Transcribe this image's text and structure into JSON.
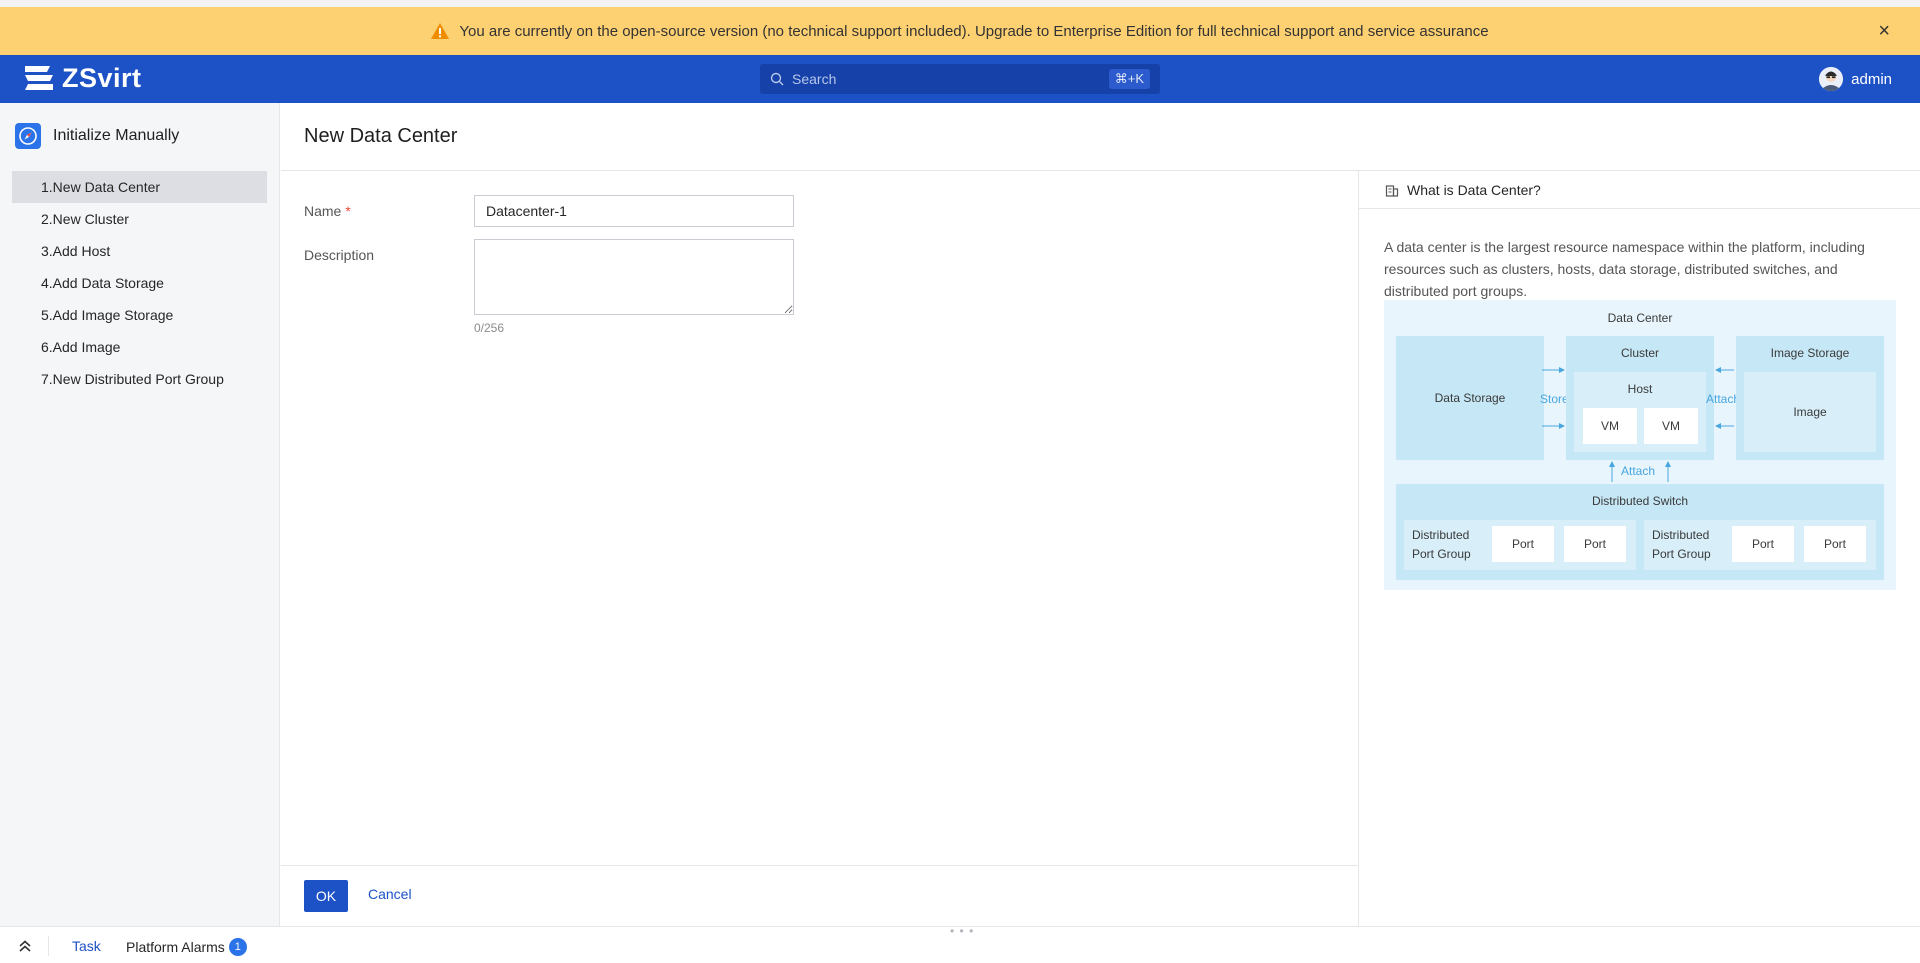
{
  "banner": {
    "message": "You are currently on the open-source version (no technical support included). Upgrade to Enterprise Edition for full technical support and service assurance",
    "close_icon": "×"
  },
  "header": {
    "logo_text": "ZSvirt",
    "search_placeholder": "Search",
    "search_shortcut": "⌘+K",
    "user_name": "admin"
  },
  "sidebar": {
    "title": "Initialize Manually",
    "steps": [
      {
        "label": "1.New Data Center",
        "active": true
      },
      {
        "label": "2.New Cluster"
      },
      {
        "label": "3.Add Host"
      },
      {
        "label": "4.Add Data Storage"
      },
      {
        "label": "5.Add Image Storage"
      },
      {
        "label": "6.Add Image"
      },
      {
        "label": "7.New Distributed Port Group"
      }
    ]
  },
  "main": {
    "title": "New Data Center",
    "name_label": "Name",
    "required_mark": "*",
    "name_value": "Datacenter-1",
    "description_label": "Description",
    "description_value": "",
    "description_counter": "0/256",
    "ok_label": "OK",
    "cancel_label": "Cancel"
  },
  "help": {
    "title": "What is Data Center?",
    "text": "A data center is the largest resource namespace within the platform, including resources such as clusters, hosts, data storage, distributed switches, and distributed port groups.",
    "diagram": {
      "data_center": "Data Center",
      "data_storage": "Data Storage",
      "store": "Store",
      "cluster": "Cluster",
      "host": "Host",
      "vm": "VM",
      "attach": "Attach",
      "image_storage": "Image Storage",
      "image": "Image",
      "distributed_switch": "Distributed Switch",
      "port_group_line1": "Distributed",
      "port_group_line2": "Port Group",
      "port": "Port"
    }
  },
  "bottom_bar": {
    "task_label": "Task",
    "alarms_label": "Platform Alarms",
    "alarms_count": "1"
  },
  "colors": {
    "primary": "#1d51c6",
    "banner": "#fdd172",
    "required": "#e5483a"
  }
}
